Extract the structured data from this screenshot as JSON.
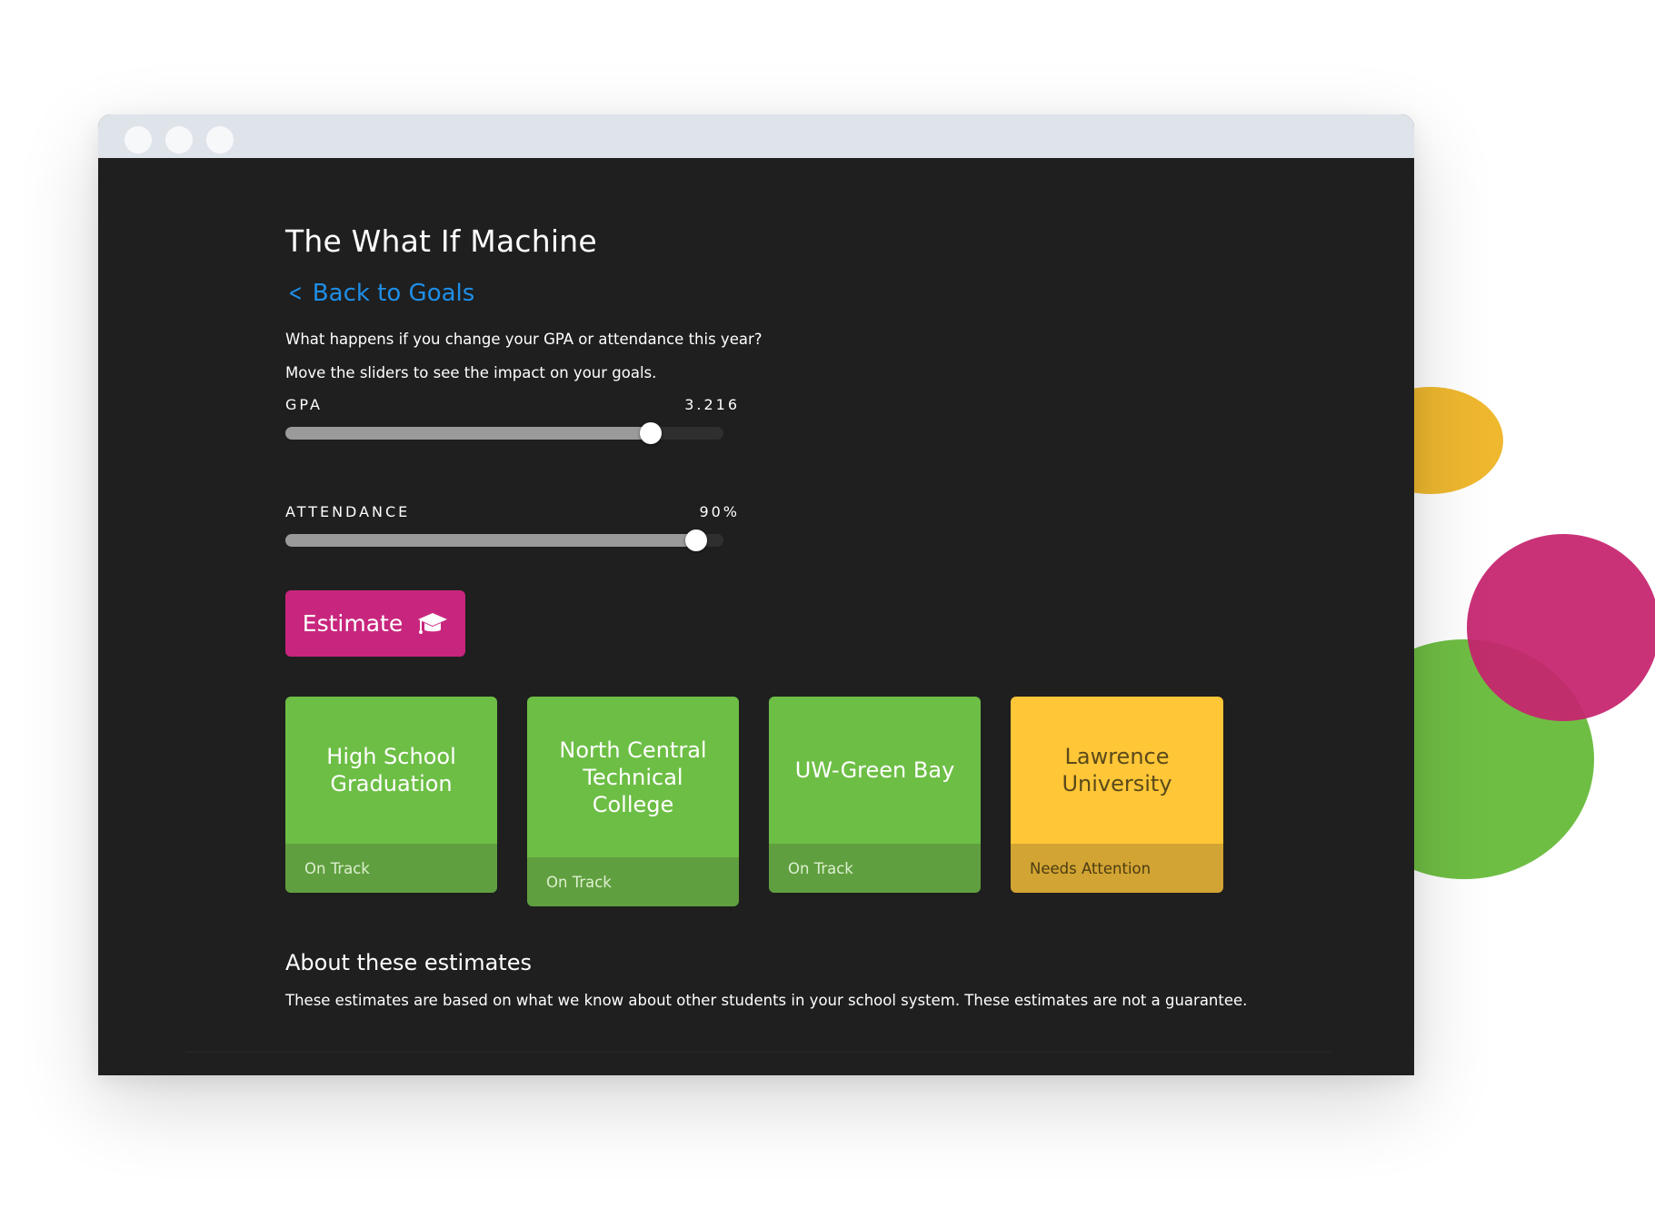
{
  "page": {
    "title": "The What If Machine",
    "back_label": "Back to Goals",
    "prompt_line_1": "What happens if you change your GPA or attendance this year?",
    "prompt_line_2": "Move the sliders to see the impact on your goals."
  },
  "sliders": {
    "gpa": {
      "label": "GPA",
      "value_text": "3.216",
      "fraction": 0.835
    },
    "attendance": {
      "label": "ATTENDANCE",
      "value_text": "90%",
      "fraction": 0.938
    }
  },
  "estimate_button": {
    "label": "Estimate",
    "icon": "graduation-cap-icon"
  },
  "goal_cards": [
    {
      "title": "High School Graduation",
      "status": "On Track",
      "status_color": "#6DBE45"
    },
    {
      "title": "North Central Technical College",
      "status": "On Track",
      "status_color": "#6DBE45"
    },
    {
      "title": "UW-Green Bay",
      "status": "On Track",
      "status_color": "#6DBE45"
    },
    {
      "title": "Lawrence University",
      "status": "Needs Attention",
      "status_color": "#FFC637"
    }
  ],
  "about": {
    "title": "About these estimates",
    "text": "These estimates are based on what we know about other students in your school system. These estimates are not a guarantee."
  },
  "colors": {
    "accent": "#C8267E",
    "link": "#1f8fe8",
    "on_track": "#6DBE45",
    "needs_attention": "#FFC637",
    "background": "#1f1f1f"
  }
}
